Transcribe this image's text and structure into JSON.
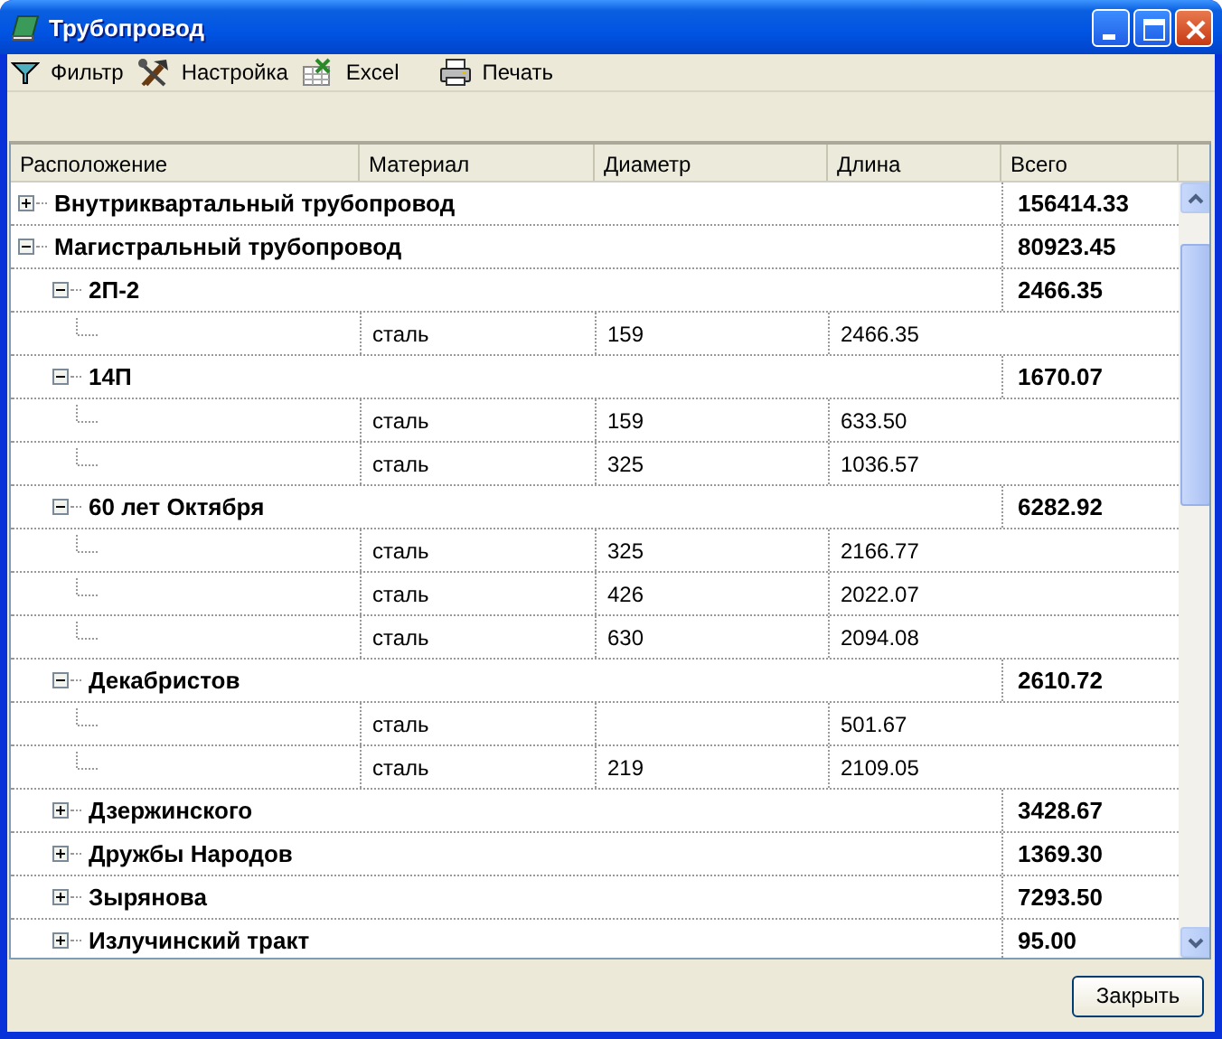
{
  "window": {
    "title": "Трубопровод"
  },
  "toolbar": [
    {
      "kind": "filter",
      "label": "Фильтр"
    },
    {
      "kind": "settings",
      "label": "Настройка"
    },
    {
      "kind": "excel",
      "label": "Excel"
    },
    {
      "kind": "print",
      "label": "Печать"
    }
  ],
  "table": {
    "columns": [
      "Расположение",
      "Материал",
      "Диаметр",
      "Длина",
      "Всего"
    ],
    "tree": [
      {
        "kind": "group",
        "name": "Внутриквартальный трубопровод",
        "total": "156414.33",
        "expanded": false
      },
      {
        "kind": "group",
        "name": "Магистральный трубопровод",
        "total": "80923.45",
        "expanded": true,
        "children": [
          {
            "kind": "group",
            "name": "2П-2",
            "total": "2466.35",
            "expanded": true,
            "children": [
              {
                "kind": "pipe",
                "material": "сталь",
                "diameter": "159",
                "length": "2466.35"
              }
            ]
          },
          {
            "kind": "group",
            "name": "14П",
            "total": "1670.07",
            "expanded": true,
            "children": [
              {
                "kind": "pipe",
                "material": "сталь",
                "diameter": "159",
                "length": "633.50"
              },
              {
                "kind": "pipe",
                "material": "сталь",
                "diameter": "325",
                "length": "1036.57"
              }
            ]
          },
          {
            "kind": "group",
            "name": "60 лет Октября",
            "total": "6282.92",
            "expanded": true,
            "children": [
              {
                "kind": "pipe",
                "material": "сталь",
                "diameter": "325",
                "length": "2166.77"
              },
              {
                "kind": "pipe",
                "material": "сталь",
                "diameter": "426",
                "length": "2022.07"
              },
              {
                "kind": "pipe",
                "material": "сталь",
                "diameter": "630",
                "length": "2094.08"
              }
            ]
          },
          {
            "kind": "group",
            "name": "Декабристов",
            "total": "2610.72",
            "expanded": true,
            "children": [
              {
                "kind": "pipe",
                "material": "сталь",
                "length": "501.67"
              },
              {
                "kind": "pipe",
                "material": "сталь",
                "diameter": "219",
                "length": "2109.05"
              }
            ]
          },
          {
            "kind": "group",
            "name": "Дзержинского",
            "total": "3428.67",
            "expanded": false
          },
          {
            "kind": "group",
            "name": "Дружбы Народов",
            "total": "1369.30",
            "expanded": false
          },
          {
            "kind": "group",
            "name": "Зырянова",
            "total": "7293.50",
            "expanded": false
          },
          {
            "kind": "group",
            "name": "Излучинский тракт",
            "total": "95.00",
            "expanded": false
          }
        ]
      }
    ]
  },
  "buttons": [
    "Закрыть"
  ]
}
